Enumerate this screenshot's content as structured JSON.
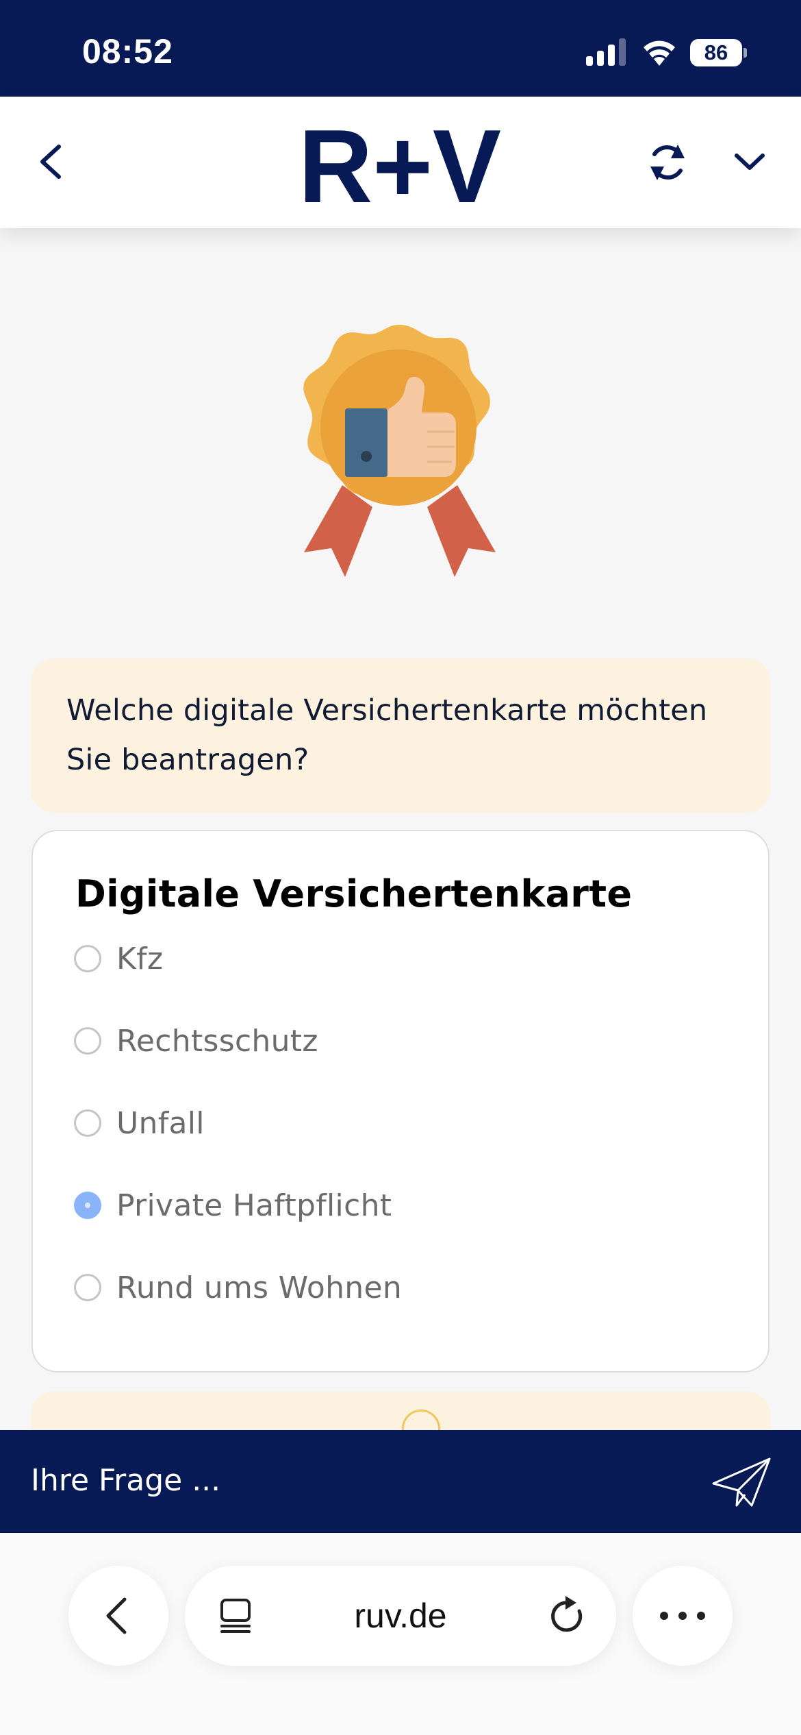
{
  "status_bar": {
    "time": "08:52",
    "battery": "86"
  },
  "header": {
    "logo_text": "R+V"
  },
  "chat": {
    "question": "Welche digitale Versichertenkarte möchten Sie beantragen?",
    "card": {
      "title": "Digitale Versichertenkarte",
      "options": [
        {
          "label": "Kfz",
          "selected": false
        },
        {
          "label": "Rechtsschutz",
          "selected": false
        },
        {
          "label": "Unfall",
          "selected": false
        },
        {
          "label": "Private Haftpflicht",
          "selected": true
        },
        {
          "label": "Rund ums Wohnen",
          "selected": false
        }
      ]
    }
  },
  "input": {
    "placeholder": "Ihre Frage ..."
  },
  "browser": {
    "url": "ruv.de"
  },
  "colors": {
    "brand_navy": "#071a55",
    "bubble_bg": "#fcf2df",
    "radio_selected": "#8ab4f8"
  }
}
